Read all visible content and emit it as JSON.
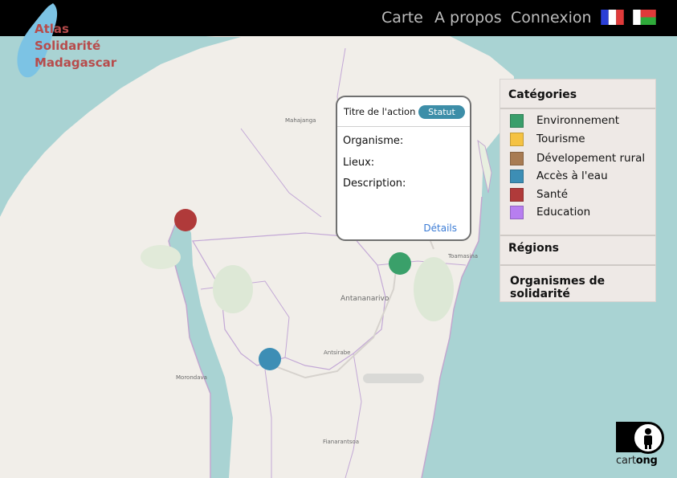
{
  "header": {
    "logo_lines": [
      "Atlas",
      "Solidarité",
      "Madagascar"
    ],
    "nav": [
      "Carte",
      "A propos",
      "Connexion"
    ],
    "flags": [
      "flag-fr-icon",
      "flag-mg-icon"
    ]
  },
  "map": {
    "places": [
      "Mahajanga",
      "Toamasina",
      "Antananarivo",
      "Antsirabe",
      "Morondava",
      "Fianarantsoa"
    ],
    "markers": [
      {
        "category": "Santé",
        "color": "#b03a3a"
      },
      {
        "category": "Environnement",
        "color": "#3aa06a"
      },
      {
        "category": "Accès à l'eau",
        "color": "#3d8eb5"
      }
    ]
  },
  "popup": {
    "title": "Titre de l'action",
    "status": "Statut",
    "fields": [
      "Organisme:",
      "Lieux:",
      "Description:"
    ],
    "details_link": "Détails"
  },
  "panel": {
    "categories_title": "Catégories",
    "categories": [
      {
        "label": "Environnement",
        "color": "#3a9e6b"
      },
      {
        "label": "Tourisme",
        "color": "#f5c242"
      },
      {
        "label": "Dévelopement rural",
        "color": "#a87b52"
      },
      {
        "label": "Accès à l'eau",
        "color": "#3d8eb5"
      },
      {
        "label": "Santé",
        "color": "#b03a3a"
      },
      {
        "label": "Education",
        "color": "#b77ef0"
      }
    ],
    "regions_title": "Régions",
    "organismes_title": "Organismes de solidarité"
  },
  "footer": {
    "brand_light": "cart",
    "brand_bold": "ong"
  }
}
